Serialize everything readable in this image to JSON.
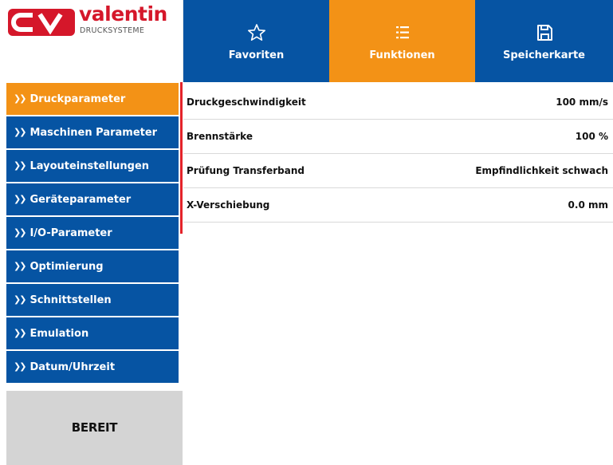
{
  "brand": {
    "name": "valentin",
    "subtitle": "DRUCKSYSTEME",
    "accent": "#d5172a"
  },
  "top_nav": [
    {
      "label": "Favoriten",
      "icon": "star-icon"
    },
    {
      "label": "Funktionen",
      "icon": "list-icon",
      "active": true
    },
    {
      "label": "Speicherkarte",
      "icon": "floppy-disk-icon"
    }
  ],
  "sidebar": {
    "items": [
      {
        "label": "Druckparameter",
        "active": true
      },
      {
        "label": "Maschinen Parameter"
      },
      {
        "label": "Layouteinstellungen"
      },
      {
        "label": "Geräteparameter"
      },
      {
        "label": "I/O-Parameter"
      },
      {
        "label": "Optimierung"
      },
      {
        "label": "Schnittstellen"
      },
      {
        "label": "Emulation"
      },
      {
        "label": "Datum/Uhrzeit"
      }
    ]
  },
  "status": {
    "text": "BEREIT"
  },
  "parameters": [
    {
      "label": "Druckgeschwindigkeit",
      "value": "100 mm/s"
    },
    {
      "label": "Brennstärke",
      "value": "100 %"
    },
    {
      "label": "Prüfung Transferband",
      "value": "Empfindlichkeit schwach"
    },
    {
      "label": "X-Verschiebung",
      "value": "0.0 mm"
    }
  ],
  "colors": {
    "blue": "#0654a3",
    "orange": "#f39216",
    "red_marker": "#e4232a",
    "status_bg": "#d4d4d4"
  }
}
